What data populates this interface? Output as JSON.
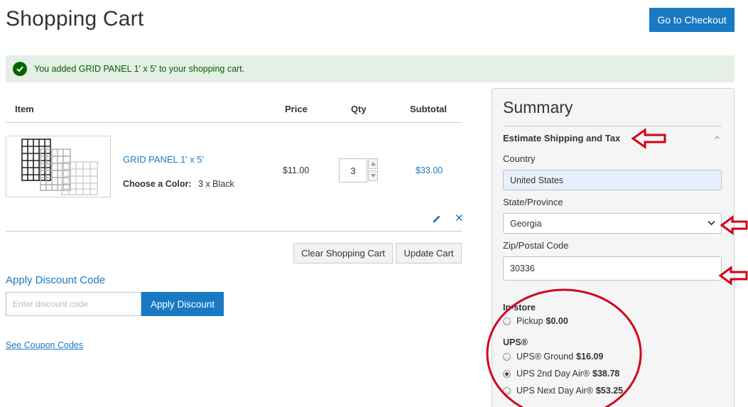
{
  "header": {
    "title": "Shopping Cart",
    "checkout_label": "Go to Checkout"
  },
  "message": {
    "text": "You added GRID PANEL 1' x 5' to your shopping cart."
  },
  "cart": {
    "columns": [
      "Item",
      "Price",
      "Qty",
      "Subtotal"
    ],
    "item": {
      "name": "GRID PANEL 1' x 5'",
      "option_label": "Choose a Color:",
      "option_value": "3 x Black",
      "price": "$11.00",
      "qty": "3",
      "subtotal": "$33.00"
    },
    "clear_label": "Clear Shopping Cart",
    "update_label": "Update Cart"
  },
  "discount": {
    "title": "Apply Discount Code",
    "placeholder": "Enter discount code",
    "button_label": "Apply Discount",
    "coupon_link": "See Coupon Codes"
  },
  "summary": {
    "title": "Summary",
    "estimate_title": "Estimate Shipping and Tax",
    "country_label": "Country",
    "country_value": "United States",
    "state_label": "State/Province",
    "state_value": "Georgia",
    "zip_label": "Zip/Postal Code",
    "zip_value": "30336",
    "shipping": [
      {
        "group": "In-store",
        "options": [
          {
            "label": "Pickup",
            "price": "$0.00",
            "selected": false
          }
        ]
      },
      {
        "group": "UPS®",
        "options": [
          {
            "label": "UPS® Ground",
            "price": "$16.09",
            "selected": false
          },
          {
            "label": "UPS 2nd Day Air®",
            "price": "$38.78",
            "selected": true
          },
          {
            "label": "UPS Next Day Air®",
            "price": "$53.25",
            "selected": false
          }
        ]
      }
    ]
  },
  "colors": {
    "primary": "#1979c3",
    "success_bg": "#e5efe5",
    "success_text": "#006400",
    "annotation_red": "#d0021b"
  }
}
